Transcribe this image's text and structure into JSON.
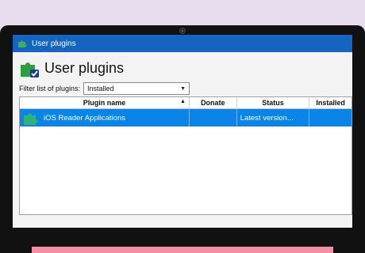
{
  "window": {
    "title": "User plugins",
    "icon": "puzzle-icon"
  },
  "header": {
    "heading": "User plugins",
    "icon": "puzzle-check-icon"
  },
  "filter": {
    "label": "Filter list of plugins:",
    "selected": "Installed"
  },
  "table": {
    "columns": [
      "Plugin name",
      "Donate",
      "Status",
      "Installed"
    ],
    "sort_indicator": "▲",
    "rows": [
      {
        "name": "iOS Reader Applications",
        "donate": "",
        "status": "Latest version...",
        "installed": "",
        "selected": true
      }
    ]
  },
  "colors": {
    "titlebar": "#1565c0",
    "selection": "#0a84e6",
    "puzzle": "#2e9e3e"
  }
}
